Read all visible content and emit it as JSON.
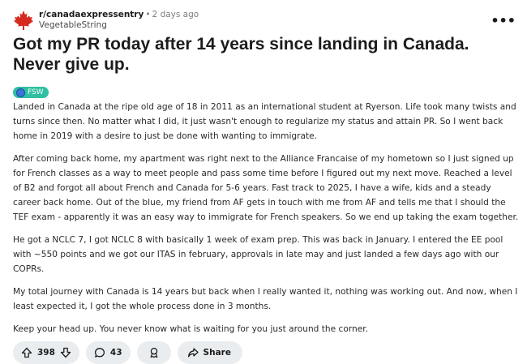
{
  "post": {
    "subreddit": "r/canadaexpressentry",
    "separator": "•",
    "time": "2 days ago",
    "username": "VegetableString",
    "more_label": "•••",
    "title": "Got my PR today after 14 years since landing in Canada. Never give up.",
    "flair": "FSW",
    "paragraphs": [
      "Landed in Canada at the ripe old age of 18 in 2011 as an international student at Ryerson. Life took many twists and turns since then. No matter what I did, it just wasn't enough to regularize my status and attain PR. So I went back home in 2019 with a desire to just be done with wanting to immigrate.",
      "After coming back home, my apartment was right next to the Alliance Francaise of my hometown so I just signed up for French classes as a way to meet people and pass some time before I figured out my next move. Reached a level of B2 and forgot all about French and Canada for 5-6 years. Fast track to 2025, I have a wife, kids and a steady career back home. Out of the blue, my friend from AF gets in touch with me from AF and tells me that I should the TEF exam - apparently it was an easy way to immigrate for French speakers. So we end up taking the exam together.",
      "He got a NCLC 7, I got NCLC 8 with basically 1 week of exam prep. This was back in January. I entered the EE pool with ~550 points and we got our ITAS in february, approvals in late may and just landed a few days ago with our COPRs.",
      "My total journey with Canada is 14 years but back when I really wanted it, nothing was working out. And now, when I least expected it, I got the whole process done in 3 months.",
      "Keep your head up. You never know what is waiting for you just around the corner."
    ],
    "actions": {
      "votes": "398",
      "comments": "43",
      "share": "Share"
    }
  },
  "colors": {
    "flair_bg": "#2fbfa2",
    "avatar_red": "#d52b1e",
    "pill_bg": "#eaedef"
  },
  "icons": [
    "maple-leaf-avatar",
    "upvote-icon",
    "downvote-icon",
    "comment-icon",
    "award-icon",
    "share-icon",
    "more-icon",
    "globe-icon"
  ]
}
